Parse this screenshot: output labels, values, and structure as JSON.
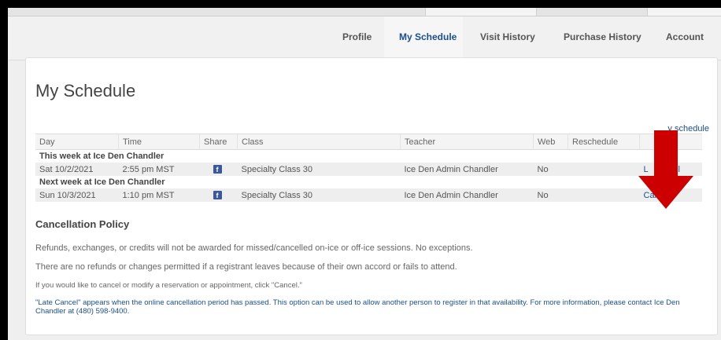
{
  "nav": {
    "items": [
      {
        "label": "Profile",
        "active": false
      },
      {
        "label": "My Schedule",
        "active": true
      },
      {
        "label": "Visit History",
        "active": false
      },
      {
        "label": "Purchase History",
        "active": false
      },
      {
        "label": "Account",
        "active": false
      }
    ]
  },
  "page": {
    "title": "My Schedule",
    "top_right_link_visible": "y schedule"
  },
  "table": {
    "headers": [
      "Day",
      "Time",
      "Share",
      "Class",
      "Teacher",
      "Web",
      "Reschedule",
      ""
    ],
    "groups": [
      {
        "label": "This week at Ice Den Chandler",
        "rows": [
          {
            "day": "Sat 10/2/2021",
            "time": "2:55 pm MST",
            "share": "facebook-icon",
            "class": "Specialty Class 30",
            "teacher": "Ice Den Admin Chandler",
            "web": "No",
            "reschedule": "",
            "action_left": "L",
            "action_right": "ancel"
          }
        ]
      },
      {
        "label": "Next week at Ice Den Chandler",
        "rows": [
          {
            "day": "Sun 10/3/2021",
            "time": "1:10 pm MST",
            "share": "facebook-icon",
            "class": "Specialty Class 30",
            "teacher": "Ice Den Admin Chandler",
            "web": "No",
            "reschedule": "",
            "action": "Cancel"
          }
        ]
      }
    ]
  },
  "policy": {
    "heading": "Cancellation Policy",
    "line1": "Refunds, exchanges, or credits will not be awarded for missed/cancelled on-ice or off-ice sessions. No exceptions.",
    "line2": "There are no refunds or changes permitted if a registrant leaves because of their own accord or fails to attend.",
    "line3": "If you would like to cancel or modify a reservation or appointment, click \"Cancel.\"",
    "note": "\"Late Cancel\" appears when the online cancellation period has passed. This option can be used to allow another person to register in that availability. For more information, please contact Ice Den Chandler at (480) 598-9400."
  },
  "colors": {
    "link": "#1a4f8b",
    "annotation_arrow": "#cc0000",
    "facebook": "#3b5998"
  }
}
